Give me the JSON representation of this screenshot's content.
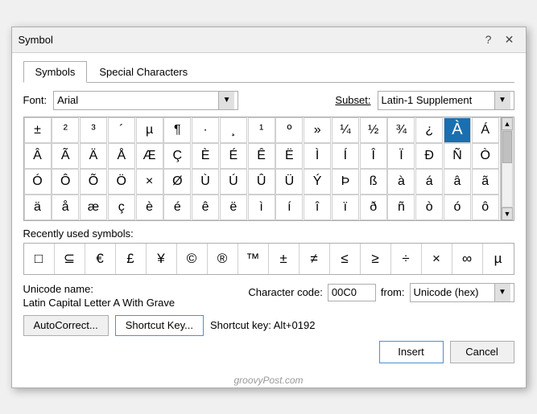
{
  "dialog": {
    "title": "Symbol",
    "tabs": [
      {
        "label": "Symbols",
        "active": true
      },
      {
        "label": "Special Characters",
        "active": false
      }
    ],
    "font_label": "Font:",
    "font_value": "Arial",
    "subset_label": "Subset:",
    "subset_value": "Latin-1 Supplement",
    "symbols_row1": [
      "±",
      "²",
      "³",
      "´",
      "µ",
      "¶",
      "·",
      "¸",
      "¹",
      "º",
      "»",
      "¼",
      "½",
      "¾",
      "¿",
      "À",
      "Á"
    ],
    "symbols_row2": [
      "Â",
      "Ã",
      "Ä",
      "Å",
      "Æ",
      "Ç",
      "È",
      "É",
      "Ê",
      "Ë",
      "Ì",
      "Í",
      "Î",
      "Ï",
      "Ð",
      "Ñ",
      "Ò"
    ],
    "symbols_row3": [
      "Ó",
      "Ô",
      "Õ",
      "Ö",
      "×",
      "Ø",
      "Ù",
      "Ú",
      "Û",
      "Ü",
      "Ý",
      "Þ",
      "ß",
      "à",
      "á",
      "â",
      "ã"
    ],
    "symbols_row4": [
      "ä",
      "å",
      "æ",
      "ç",
      "è",
      "é",
      "ê",
      "ë",
      "ì",
      "í",
      "î",
      "ï",
      "ð",
      "ñ",
      "ò",
      "ó",
      "ô"
    ],
    "selected_symbol": "À",
    "recently_used_label": "Recently used symbols:",
    "recent_symbols": [
      "□",
      "⊆",
      "€",
      "£",
      "¥",
      "©",
      "®",
      "™",
      "±",
      "≠",
      "≤",
      "≥",
      "÷",
      "×",
      "∞",
      "µ"
    ],
    "unicode_label": "Unicode name:",
    "unicode_name": "Latin Capital Letter A With Grave",
    "charcode_label": "Character code:",
    "charcode_value": "00C0",
    "from_label": "from:",
    "from_value": "Unicode (hex)",
    "autocorrect_btn": "AutoCorrect...",
    "shortcut_key_btn": "Shortcut Key...",
    "shortcut_key_text": "Shortcut key: Alt+0192",
    "insert_btn": "Insert",
    "cancel_btn": "Cancel",
    "watermark": "groovyPost.com",
    "help_btn": "?",
    "close_btn": "✕"
  }
}
